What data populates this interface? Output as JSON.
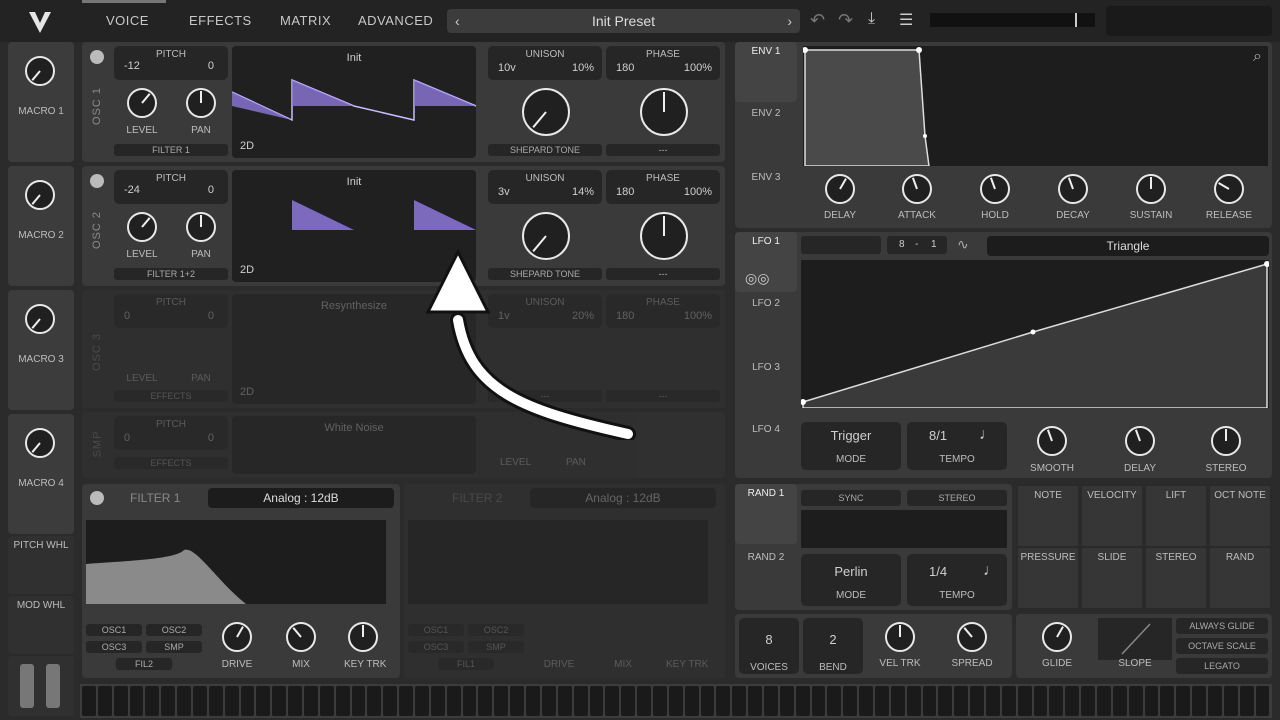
{
  "nav": {
    "tabs": [
      "VOICE",
      "EFFECTS",
      "MATRIX",
      "ADVANCED"
    ],
    "preset": "Init Preset"
  },
  "macros": [
    "MACRO 1",
    "MACRO 2",
    "MACRO 3",
    "MACRO 4"
  ],
  "wheels": [
    "PITCH WHL",
    "MOD WHL"
  ],
  "osc": [
    {
      "label": "OSC 1",
      "pitch_label": "PITCH",
      "pitch_l": "-12",
      "pitch_r": "0",
      "level": "LEVEL",
      "pan": "PAN",
      "dest": "FILTER 1",
      "wave": "Init",
      "dim": "2D",
      "unison": "UNISON",
      "uni_l": "10v",
      "uni_r": "10%",
      "phase": "PHASE",
      "ph_l": "180",
      "ph_r": "100%",
      "tone": "SHEPARD TONE",
      "ph_sel": "---"
    },
    {
      "label": "OSC 2",
      "pitch_label": "PITCH",
      "pitch_l": "-24",
      "pitch_r": "0",
      "level": "LEVEL",
      "pan": "PAN",
      "dest": "FILTER 1+2",
      "wave": "Init",
      "dim": "2D",
      "unison": "UNISON",
      "uni_l": "3v",
      "uni_r": "14%",
      "phase": "PHASE",
      "ph_l": "180",
      "ph_r": "100%",
      "tone": "SHEPARD TONE",
      "ph_sel": "---"
    },
    {
      "label": "OSC 3",
      "pitch_label": "PITCH",
      "pitch_l": "0",
      "pitch_r": "0",
      "level": "LEVEL",
      "pan": "PAN",
      "dest": "EFFECTS",
      "wave": "Resynthesize",
      "dim": "2D",
      "unison": "UNISON",
      "uni_l": "1v",
      "uni_r": "20%",
      "phase": "PHASE",
      "ph_l": "180",
      "ph_r": "100%",
      "tone": "---",
      "ph_sel": "---"
    }
  ],
  "smp": {
    "label": "SMP",
    "pitch_label": "PITCH",
    "pitch_l": "0",
    "pitch_r": "0",
    "dest": "EFFECTS",
    "sample": "White Noise",
    "level": "LEVEL",
    "pan": "PAN"
  },
  "filter1": {
    "title": "FILTER 1",
    "type": "Analog : 12dB",
    "routes": [
      "OSC1",
      "OSC2",
      "OSC3",
      "SMP",
      "FIL2"
    ],
    "drive": "DRIVE",
    "mix": "MIX",
    "keytrk": "KEY TRK"
  },
  "filter2": {
    "title": "FILTER 2",
    "type": "Analog : 12dB",
    "routes": [
      "OSC1",
      "OSC2",
      "OSC3",
      "SMP",
      "FIL1"
    ],
    "drive": "DRIVE",
    "mix": "MIX",
    "keytrk": "KEY TRK"
  },
  "env": {
    "tabs": [
      "ENV 1",
      "ENV 2",
      "ENV 3"
    ],
    "knobs": [
      "DELAY",
      "ATTACK",
      "HOLD",
      "DECAY",
      "SUSTAIN",
      "RELEASE"
    ]
  },
  "lfo": {
    "tabs": [
      "LFO 1",
      "LFO 2",
      "LFO 3",
      "LFO 4"
    ],
    "grid_l": "8",
    "grid_sep": "-",
    "grid_r": "1",
    "shape": "Triangle",
    "mode_val": "Trigger",
    "mode": "MODE",
    "tempo_val": "8/1",
    "tempo": "TEMPO",
    "knobs": [
      "SMOOTH",
      "DELAY",
      "STEREO"
    ]
  },
  "rand": {
    "tabs": [
      "RAND 1",
      "RAND 2"
    ],
    "sync": "SYNC",
    "stereo": "STEREO",
    "mode_val": "Perlin",
    "mode": "MODE",
    "tempo_val": "1/4",
    "tempo": "TEMPO"
  },
  "mods": [
    "NOTE",
    "VELOCITY",
    "LIFT",
    "OCT NOTE",
    "PRESSURE",
    "SLIDE",
    "STEREO",
    "RAND"
  ],
  "voice": {
    "voices_val": "8",
    "voices": "VOICES",
    "bend_val": "2",
    "bend": "BEND",
    "veltrk": "VEL TRK",
    "spread": "SPREAD",
    "glide": "GLIDE",
    "slope": "SLOPE",
    "always": "ALWAYS GLIDE",
    "octave": "OCTAVE SCALE",
    "legato": "LEGATO"
  },
  "colors": {
    "wave": "#9a86e0",
    "bg": "#2b2b2b",
    "panel": "#3a3a3a"
  }
}
